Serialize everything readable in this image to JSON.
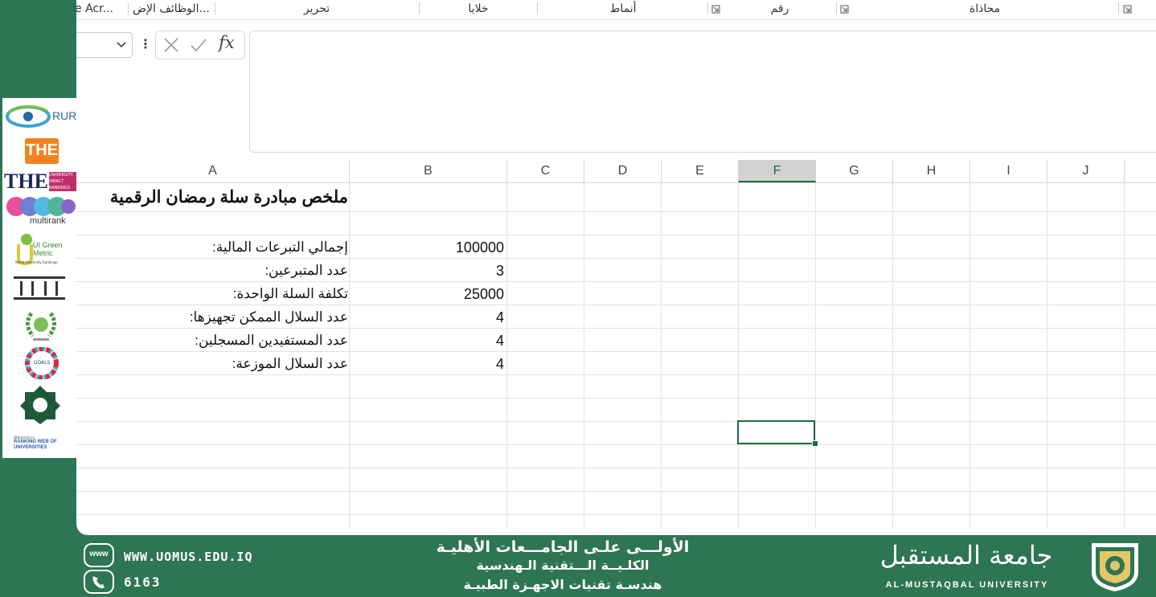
{
  "ribbon": {
    "groups": [
      "e Acr...",
      "الوظائف الإض...",
      "تحرير",
      "خلايا",
      "أنماط",
      "رقم",
      "محاذاة"
    ]
  },
  "formula_bar": {
    "name_box_value": "",
    "cancel_icon": "close-icon",
    "enter_icon": "check-icon",
    "fx_label": "fx",
    "formula_value": ""
  },
  "sheet": {
    "columns": [
      "A",
      "B",
      "C",
      "D",
      "E",
      "F",
      "G",
      "H",
      "I",
      "J"
    ],
    "selected_column": "F",
    "title": "ملخص مبادرة سلة رمضان الرقمية",
    "rows": [
      {
        "label": "إجمالي التبرعات المالية:",
        "value": "100000"
      },
      {
        "label": "عدد المتبرعين:",
        "value": "3"
      },
      {
        "label": "تكلفة السلة الواحدة:",
        "value": "25000"
      },
      {
        "label": "عدد السلال الممكن تجهيزها:",
        "value": "4"
      },
      {
        "label": "عدد المستفيدين المسجلين:",
        "value": "4"
      },
      {
        "label": "عدد السلال الموزعة:",
        "value": "4"
      }
    ]
  },
  "logos": {
    "rur": "RUR",
    "the": "THE",
    "the_impact": "THE",
    "the_impact_sub": "UNIVERSITY IMPACT RANKINGS",
    "multirank": "multirank",
    "greenmetric": "UI Green Metric",
    "greenmetric_sub": "World University Rankings",
    "sdg": "GOALS",
    "webometrics_top": "Webometrics",
    "webometrics": "RANKING WEB OF UNIVERSITIES"
  },
  "footer": {
    "website": "WWW.UOMUS.EDU.IQ",
    "phone": "6163",
    "line1": "الأولـــى علـى الجامـــعات الأهليـة",
    "line2": "الكلـيــة الـــتقنية الـهندسية",
    "line3": "هندسـة تقنيات الاجهـزة الطبيـة",
    "university_ar": "جامعة المستقبل",
    "university_en": "AL-MUSTAQBAL UNIVERSITY",
    "www_icon_text": "www"
  },
  "colors": {
    "background_green": "#2d7553",
    "excel_accent": "#1e6b41"
  }
}
